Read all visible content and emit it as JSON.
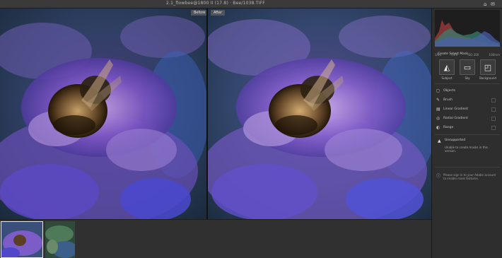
{
  "window": {
    "title": "2.1_flowbee@1800 II (17.8)  ·  Bee/1038.TIFF",
    "icon_left": "⌂",
    "icon_right": "✉"
  },
  "views": {
    "before_label": "Before",
    "after_label": "After"
  },
  "panel": {
    "histogram_readout": [
      "1/60",
      "f/4.0",
      "ISO 200",
      "100mm"
    ],
    "tools_title": "Create Smart Mask",
    "tools": [
      {
        "label": "Subject",
        "icon": "subject-icon",
        "glyph": "◭"
      },
      {
        "label": "Sky",
        "icon": "sky-icon",
        "glyph": "▭"
      },
      {
        "label": "Background",
        "icon": "background-icon",
        "glyph": "◰"
      }
    ],
    "rows": [
      {
        "label": "Objects",
        "icon": "objects-icon",
        "glyph": "◻"
      },
      {
        "label": "Brush",
        "icon": "brush-icon",
        "glyph": "✎"
      },
      {
        "label": "Linear Gradient",
        "icon": "linear-gradient-icon",
        "glyph": "▤"
      },
      {
        "label": "Radial Gradient",
        "icon": "radial-gradient-icon",
        "glyph": "◎"
      },
      {
        "label": "Range",
        "icon": "range-icon",
        "glyph": "◐"
      }
    ],
    "warning": {
      "icon": "warning-icon",
      "glyph": "▲",
      "heading": "Unsupported",
      "body": "Unable to create masks in this version."
    },
    "info": {
      "icon": "info-icon",
      "glyph": "ⓘ",
      "body": "Please sign in to your Adobe account to enable mask features."
    }
  }
}
